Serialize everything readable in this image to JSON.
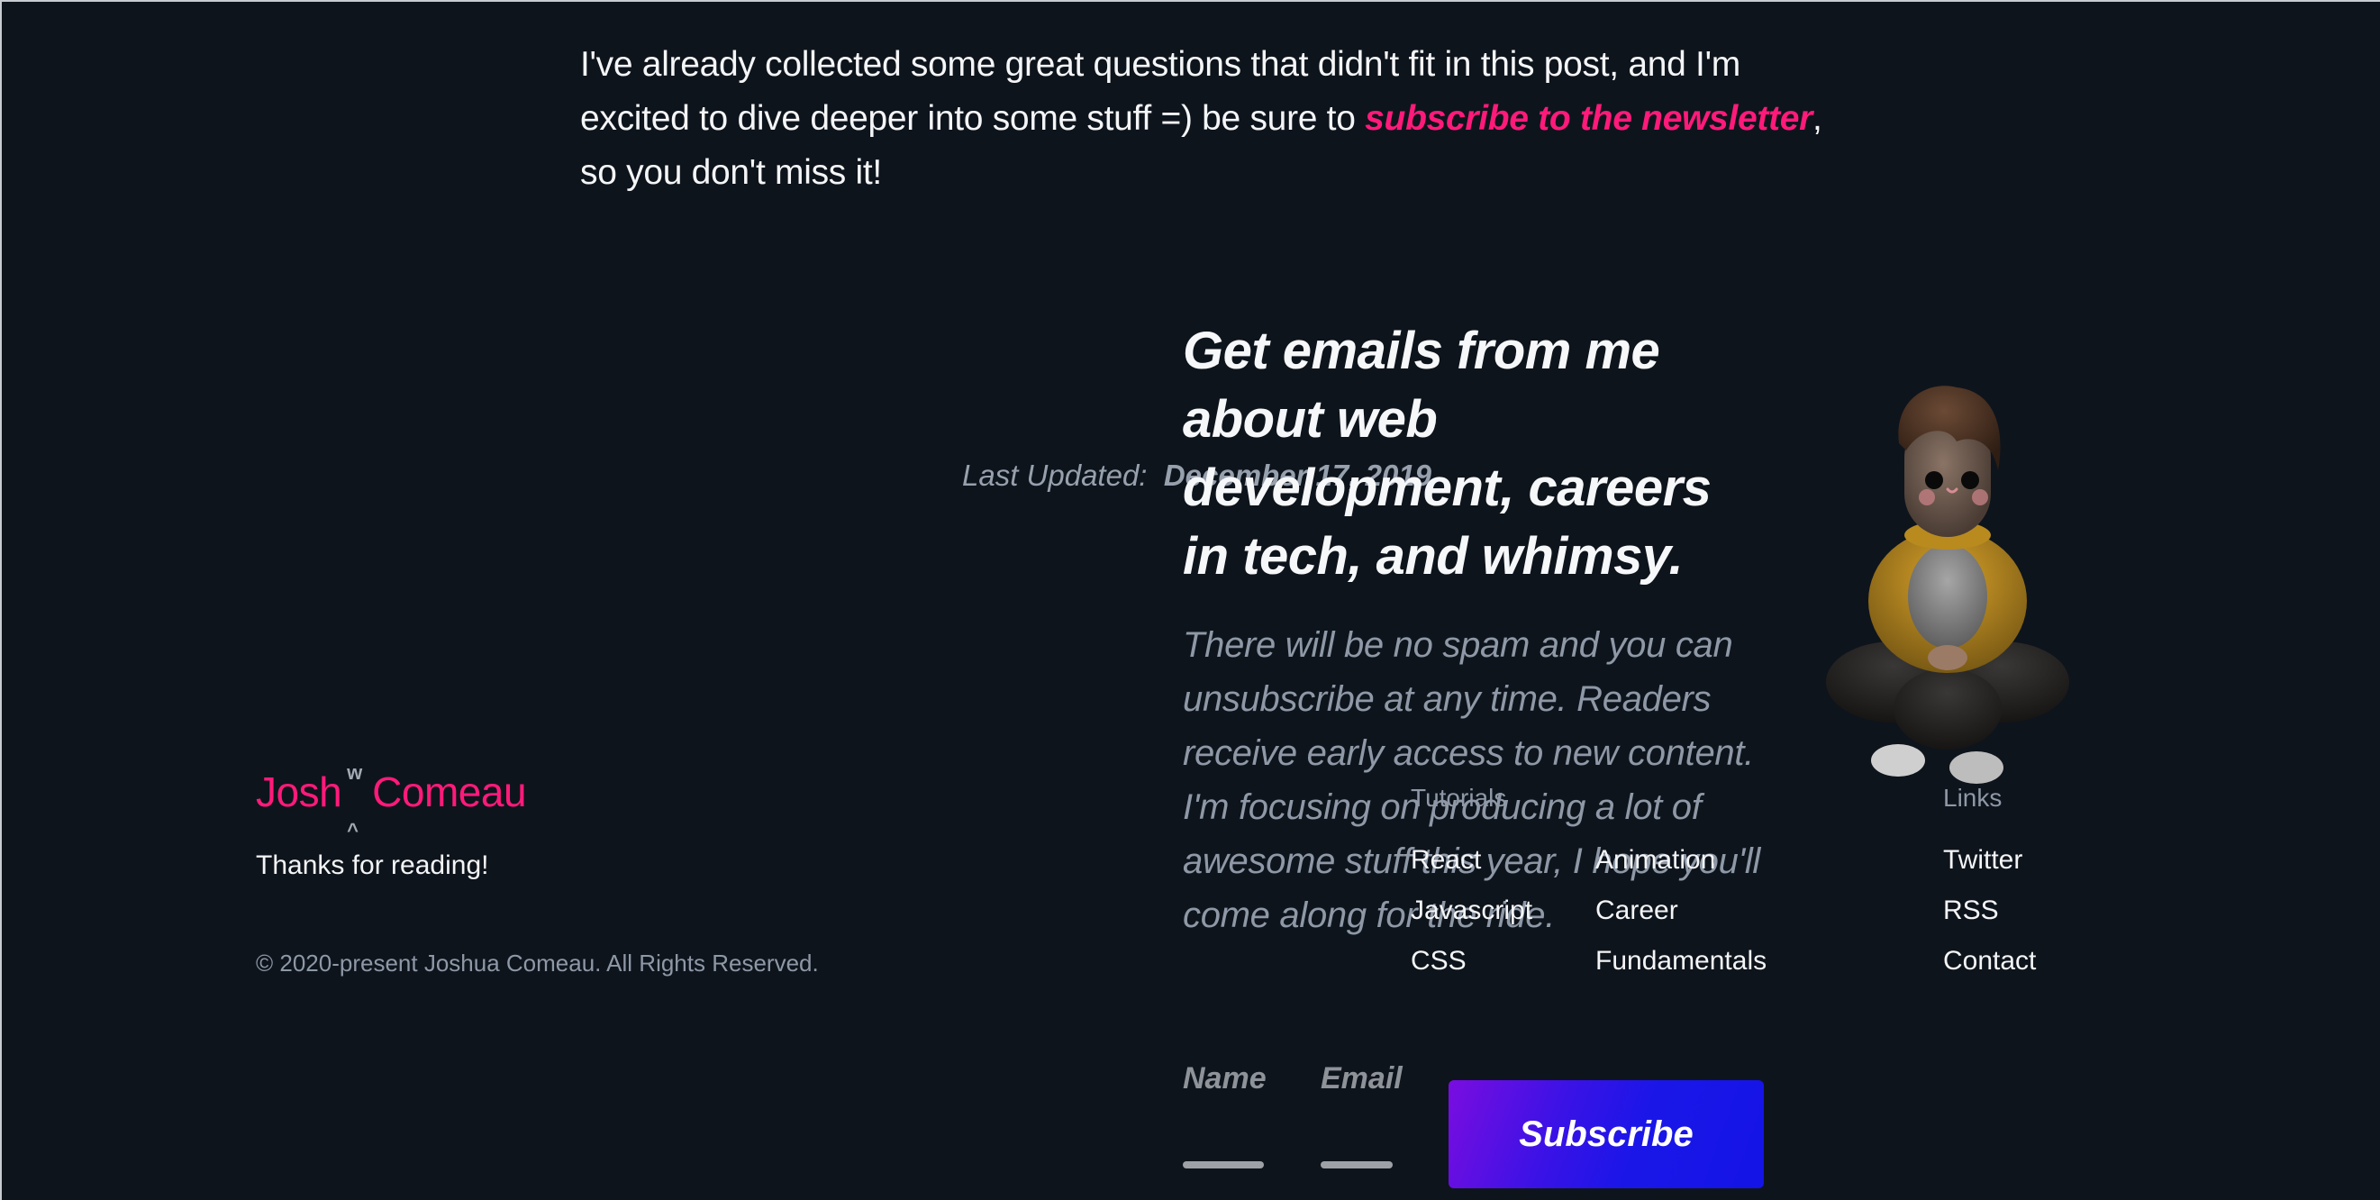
{
  "article": {
    "closing_paragraph_before": "I've already collected some great questions that didn't fit in this post, and I'm excited to dive deeper into some stuff =) be sure to ",
    "closing_paragraph_link": "subscribe to the newsletter",
    "closing_paragraph_after": ", so you don't miss it!",
    "last_updated_label": "Last Updated:",
    "last_updated_date": "December 17, 2019"
  },
  "newsletter": {
    "heading": "Get emails from me about web development, careers in tech, and whimsy.",
    "body": "There will be no spam and you can unsubscribe at any time. Readers receive early access to new content. I'm focusing on producing a lot of awesome stuff this year, I hope you'll come along for the ride.",
    "name_label": "Name",
    "name_value": "",
    "email_label": "Email",
    "email_value": "",
    "subscribe_label": "Subscribe",
    "illustration": "sitting-character-illustration"
  },
  "footer": {
    "logo_first": "Josh",
    "logo_mark_top": "w",
    "logo_mark_bottom": "^",
    "logo_second": "Comeau",
    "thanks": "Thanks for reading!",
    "copyright": "© 2020-present Joshua Comeau. All Rights Reserved.",
    "tutorials_heading": "Tutorials",
    "tutorials": [
      {
        "label": "React"
      },
      {
        "label": "Javascript"
      },
      {
        "label": "CSS"
      },
      {
        "label": "Animation"
      },
      {
        "label": "Career"
      },
      {
        "label": "Fundamentals"
      }
    ],
    "links_heading": "Links",
    "links": [
      {
        "label": "Twitter"
      },
      {
        "label": "RSS"
      },
      {
        "label": "Contact"
      }
    ]
  },
  "colors": {
    "background": "#0e141c",
    "accent_pink": "#ff1a7a",
    "muted_text": "#8e98a6",
    "button_gradient_start": "#7a0de0",
    "button_gradient_end": "#1414e6"
  }
}
